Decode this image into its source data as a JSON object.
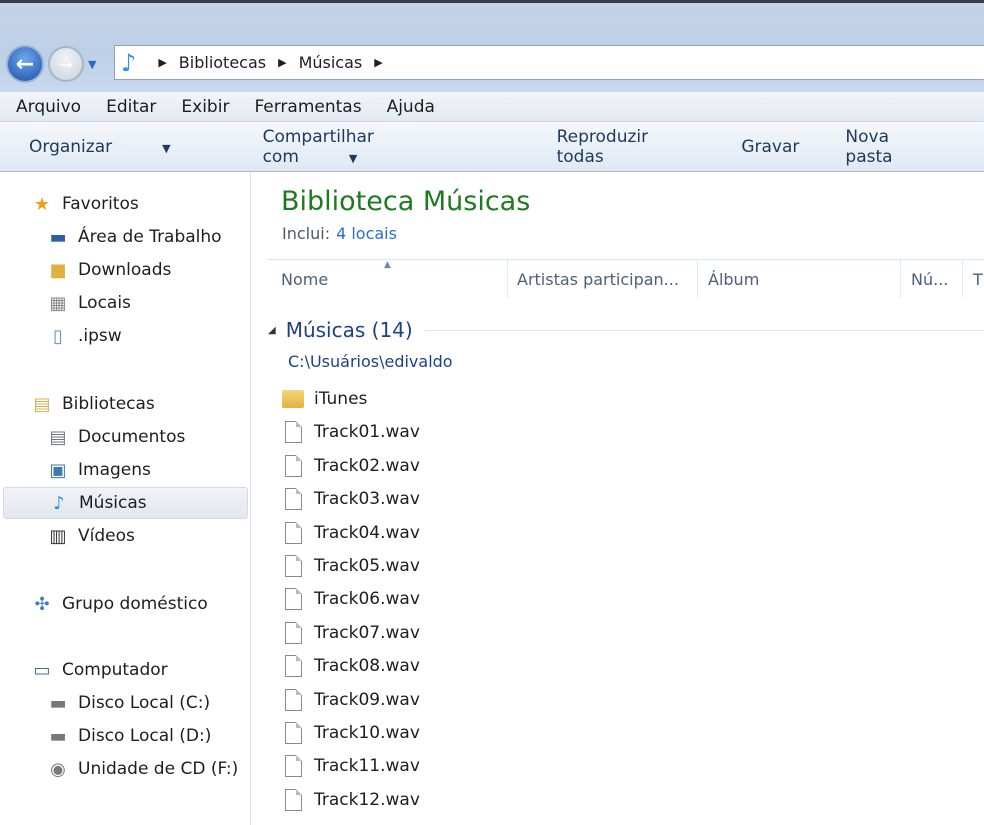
{
  "address": {
    "crumbs": [
      "Bibliotecas",
      "Músicas"
    ]
  },
  "menu": [
    "Arquivo",
    "Editar",
    "Exibir",
    "Ferramentas",
    "Ajuda"
  ],
  "commands": {
    "organize": "Organizar",
    "share": "Compartilhar com",
    "play_all": "Reproduzir todas",
    "burn": "Gravar",
    "new_folder": "Nova pasta"
  },
  "sidebar": {
    "favorites": {
      "label": "Favoritos",
      "items": [
        "Área de Trabalho",
        "Downloads",
        "Locais",
        ".ipsw"
      ]
    },
    "libraries": {
      "label": "Bibliotecas",
      "items": [
        "Documentos",
        "Imagens",
        "Músicas",
        "Vídeos"
      ]
    },
    "homegroup": "Grupo doméstico",
    "computer": {
      "label": "Computador",
      "items": [
        "Disco Local (C:)",
        "Disco Local (D:)",
        "Unidade de CD (F:)"
      ]
    }
  },
  "main": {
    "title": "Biblioteca Músicas",
    "includes_label": "Inclui:",
    "includes_link": "4 locais",
    "columns": [
      "Nome",
      "Artistas participan...",
      "Álbum",
      "Nú...",
      "T"
    ],
    "group_title": "Músicas (14)",
    "group_path": "C:\\Usuários\\edivaldo",
    "files": [
      "iTunes",
      "Track01.wav",
      "Track02.wav",
      "Track03.wav",
      "Track04.wav",
      "Track05.wav",
      "Track06.wav",
      "Track07.wav",
      "Track08.wav",
      "Track09.wav",
      "Track10.wav",
      "Track11.wav",
      "Track12.wav"
    ]
  }
}
